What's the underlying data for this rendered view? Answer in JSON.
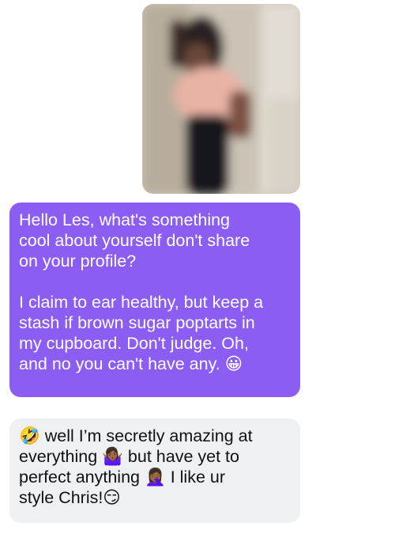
{
  "conversation": {
    "photo": {
      "description_icon": "blurred-profile-photo"
    },
    "messages": [
      {
        "direction": "outgoing",
        "text": "Hello Les, what's something\ncool about yourself don't share\non your profile?\n\nI claim to ear healthy, but keep a\nstash if brown sugar poptarts in\nmy cupboard. Don't judge.  Oh,\nand no you can't have any. 😀"
      },
      {
        "direction": "incoming",
        "text": "🤣 well I’m secretly amazing at\neverything 🤷🏾‍♀️ but have yet to\nperfect anything 🤦🏾‍♀️ I like ur\nstyle Chris!😏"
      }
    ],
    "colors": {
      "outgoing_bubble": "#8c5df3",
      "incoming_bubble": "#eff0f2"
    }
  }
}
